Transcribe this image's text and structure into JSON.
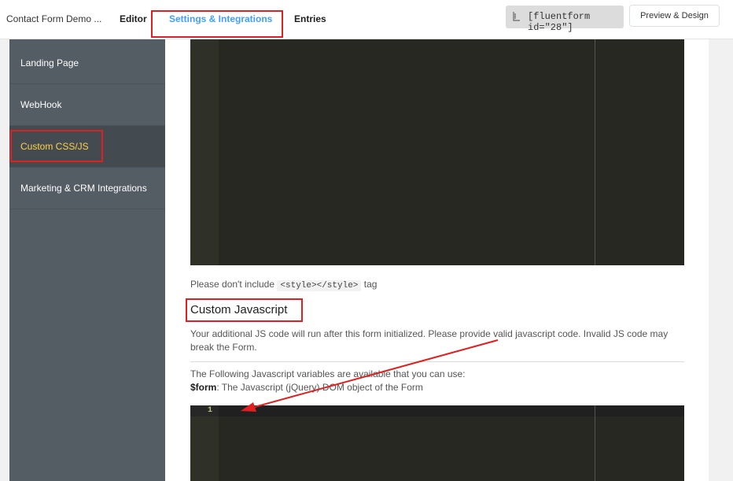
{
  "header": {
    "form_name": "Contact Form Demo ...",
    "tabs": [
      {
        "label": "Editor"
      },
      {
        "label": "Settings & Integrations"
      },
      {
        "label": "Entries"
      }
    ],
    "shortcode": "[fluentform id=\"28\"]",
    "preview_label": "Preview & Design"
  },
  "sidebar": {
    "items": [
      {
        "label": "Landing Page"
      },
      {
        "label": "WebHook"
      },
      {
        "label": "Custom CSS/JS"
      },
      {
        "label": "Marketing & CRM Integrations"
      }
    ]
  },
  "css_section": {
    "note_before": "Please don't include",
    "note_code": "<style></style>",
    "note_after": "tag"
  },
  "js_section": {
    "title": "Custom Javascript",
    "description": "Your additional JS code will run after this form initialized. Please provide valid javascript code. Invalid JS code may break the Form.",
    "vars_intro": "The Following Javascript variables are available that you can use:",
    "var_name": "$form",
    "var_desc": ": The Javascript (jQuery) DOM object of the Form",
    "line_number": "1"
  },
  "colors": {
    "accent": "#409eff",
    "sidebar_active_text": "#ffd04b",
    "annotation": "#e02020"
  }
}
